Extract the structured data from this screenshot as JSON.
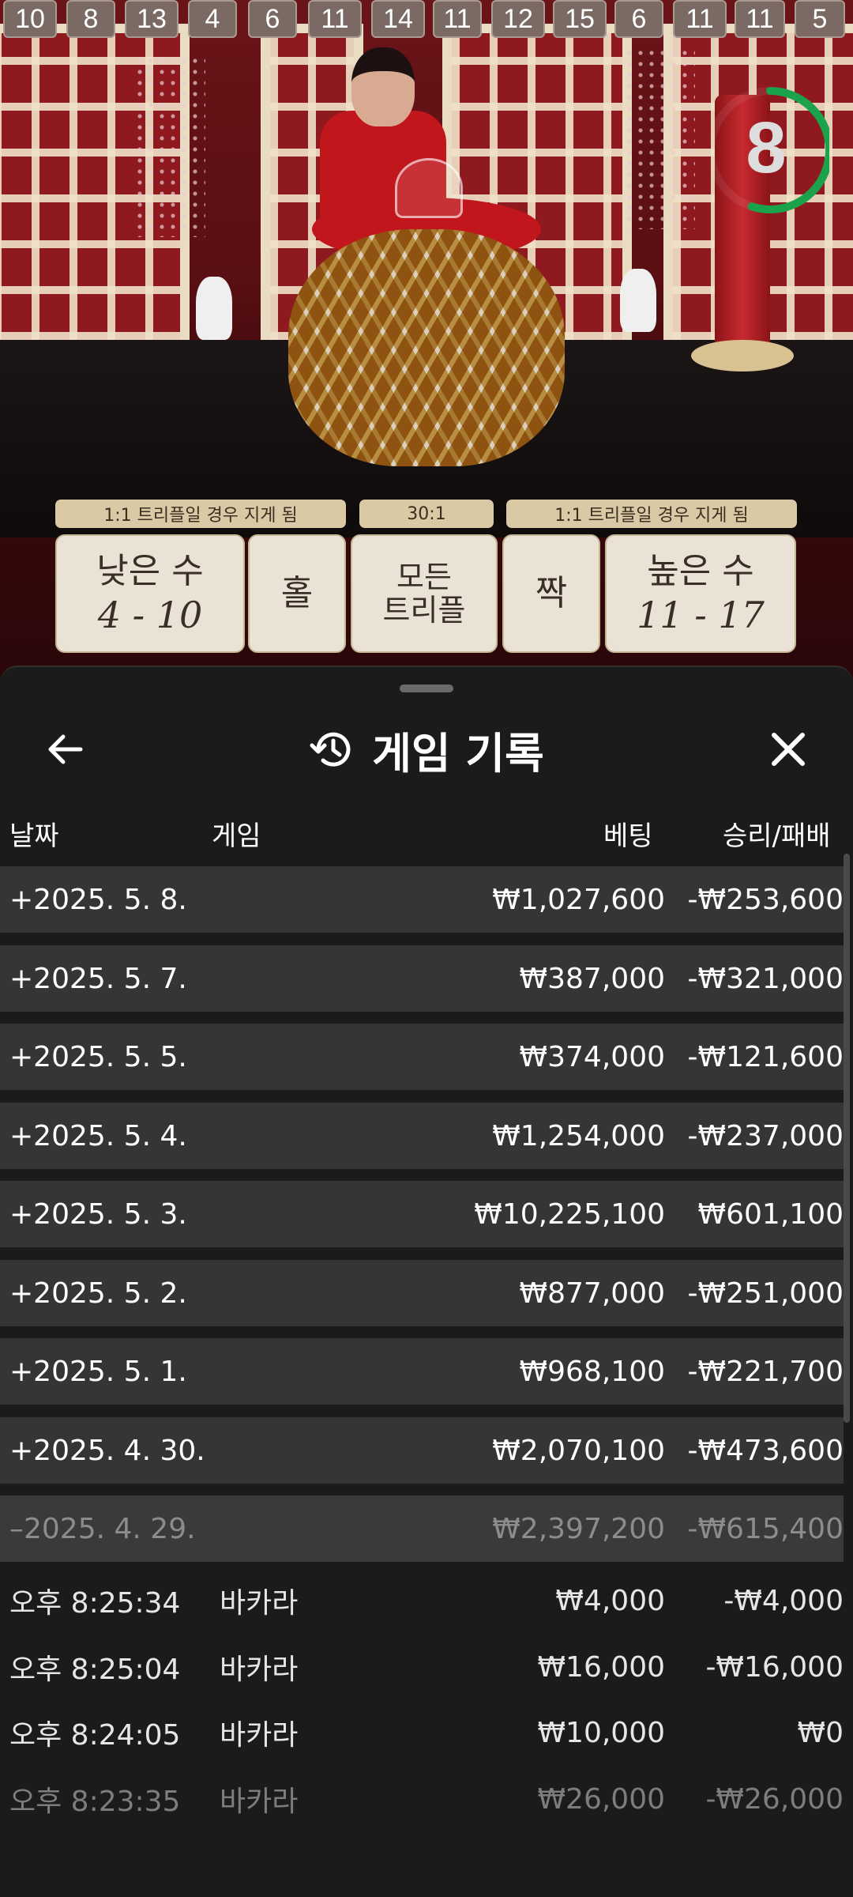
{
  "road_numbers": [
    "10",
    "8",
    "13",
    "4",
    "6",
    "11",
    "14",
    "11",
    "12",
    "15",
    "6",
    "11",
    "11",
    "5"
  ],
  "timer": {
    "value": "8",
    "progress": 0.55,
    "color": "#1aa34a"
  },
  "payouts": {
    "left": "1:1 트리플일 경우 지게 됨",
    "middle": "30:1",
    "right": "1:1 트리플일 경우 지게 됨"
  },
  "bets": {
    "low": {
      "label": "낮은 수",
      "range": "4 - 10"
    },
    "odd": {
      "label": "홀"
    },
    "any_triple": {
      "line1": "모든",
      "line2": "트리플"
    },
    "even": {
      "label": "짝"
    },
    "high": {
      "label": "높은 수",
      "range": "11 - 17"
    }
  },
  "history": {
    "title": "게임 기록",
    "columns": {
      "date": "날짜",
      "game": "게임",
      "bet": "베팅",
      "win_loss": "승리/패배"
    },
    "days": [
      {
        "date": "+2025. 5. 8.",
        "bet": "₩1,027,600",
        "win_loss": "-₩253,600"
      },
      {
        "date": "+2025. 5. 7.",
        "bet": "₩387,000",
        "win_loss": "-₩321,000"
      },
      {
        "date": "+2025. 5. 5.",
        "bet": "₩374,000",
        "win_loss": "-₩121,600"
      },
      {
        "date": "+2025. 5. 4.",
        "bet": "₩1,254,000",
        "win_loss": "-₩237,000"
      },
      {
        "date": "+2025. 5. 3.",
        "bet": "₩10,225,100",
        "win_loss": "₩601,100"
      },
      {
        "date": "+2025. 5. 2.",
        "bet": "₩877,000",
        "win_loss": "-₩251,000"
      },
      {
        "date": "+2025. 5. 1.",
        "bet": "₩968,100",
        "win_loss": "-₩221,700"
      },
      {
        "date": "+2025. 4. 30.",
        "bet": "₩2,070,100",
        "win_loss": "-₩473,600"
      },
      {
        "date": "–2025. 4. 29.",
        "bet": "₩2,397,200",
        "win_loss": "-₩615,400"
      }
    ],
    "rounds": [
      {
        "time": "오후 8:25:34",
        "game": "바카라",
        "bet": "₩4,000",
        "win_loss": "-₩4,000"
      },
      {
        "time": "오후 8:25:04",
        "game": "바카라",
        "bet": "₩16,000",
        "win_loss": "-₩16,000"
      },
      {
        "time": "오후 8:24:05",
        "game": "바카라",
        "bet": "₩10,000",
        "win_loss": "₩0"
      },
      {
        "time": "오후 8:23:35",
        "game": "바카라",
        "bet": "₩26,000",
        "win_loss": "-₩26,000"
      }
    ]
  }
}
